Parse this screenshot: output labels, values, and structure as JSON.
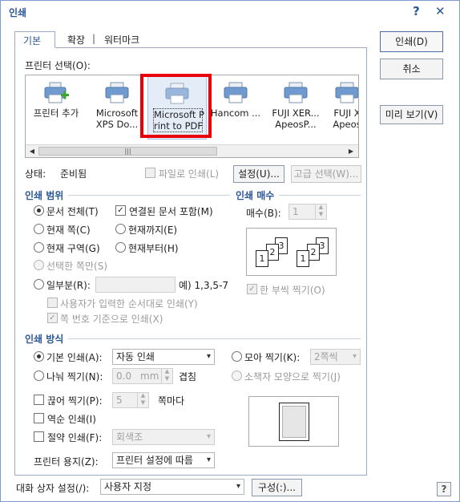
{
  "window": {
    "title": "인쇄",
    "help": "?",
    "close": "✕"
  },
  "tabs": [
    {
      "label": "기본"
    },
    {
      "label": "확장"
    },
    {
      "label": "워터마크"
    }
  ],
  "tab_separator": "|",
  "printer_select": {
    "label": "프린터 선택(O):",
    "printers": [
      {
        "name": "프린터 추가",
        "icon": "add-printer-icon"
      },
      {
        "name": "Microsoft\nXPS Do...",
        "icon": "printer-icon"
      },
      {
        "name": "Microsoft P\nrint to PDF",
        "icon": "printer-icon",
        "selected": true
      },
      {
        "name": "Hancom ...",
        "icon": "printer-icon"
      },
      {
        "name": "FUJI XER...\nApeosP...",
        "icon": "printer-icon"
      },
      {
        "name": "FUJI X\nApeos",
        "icon": "printer-icon"
      }
    ],
    "scroll_thumb": "|||"
  },
  "status": {
    "label": "상태:",
    "value": "준비됨",
    "print_to_file": "파일로 인쇄(L)",
    "settings_button": "설정(U)...",
    "advanced_button": "고급 선택(W)..."
  },
  "print_range": {
    "title": "인쇄 범위",
    "all": "문서 전체(T)",
    "include_linked": "연결된 문서 포함(M)",
    "current_page": "현재 쪽(C)",
    "up_to_current": "현재까지(E)",
    "current_section": "현재 구역(G)",
    "from_current": "현재부터(H)",
    "selected_pages": "선택한 쪽만(S)",
    "partial": "일부분(R):",
    "partial_example": "예) 1,3,5-7",
    "user_order": "사용자가 입력한 순서대로 인쇄(Y)",
    "page_number_order": "쪽 번호 기준으로 인쇄(X)"
  },
  "copies": {
    "title": "인쇄 매수",
    "label": "매수(B):",
    "value": "1",
    "collate": "한 부씩 찍기(O)"
  },
  "print_method": {
    "title": "인쇄 방식",
    "basic": "기본 인쇄(A):",
    "basic_value": "자동 인쇄",
    "collect": "모아 찍기(K):",
    "collect_value": "2쪽씩",
    "split": "나눠 찍기(N):",
    "split_value": "0.0",
    "split_unit": "mm",
    "overlap": "겹침",
    "booklet": "소책자 모양으로 찍기(J)",
    "cut": "끊어 찍기(P):",
    "cut_value": "5",
    "per_page": "쪽마다",
    "reverse": "역순 인쇄(I)",
    "save": "절약 인쇄(F):",
    "save_value": "회색조",
    "paper_label": "프린터 용지(Z):",
    "paper_value": "프린터 설정에 따름"
  },
  "right_buttons": {
    "print": "인쇄(D)",
    "cancel": "취소",
    "preview": "미리 보기(V)"
  },
  "footer": {
    "label": "대화 상자 설정(/):",
    "value": "사용자 지정",
    "config_button": "구성(:)...",
    "help": "?"
  },
  "preview_pages": [
    "1",
    "2",
    "3"
  ],
  "colors": {
    "accent": "#2b5797",
    "highlight": "#e8000a"
  }
}
